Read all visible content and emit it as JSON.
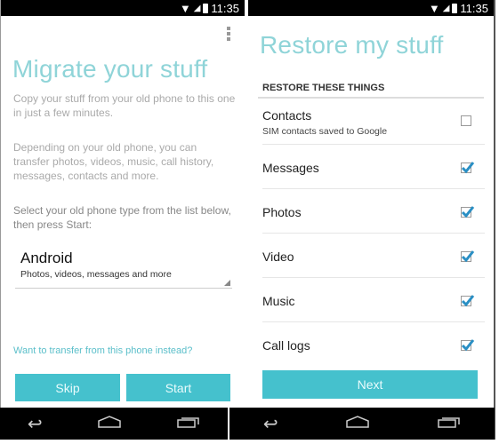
{
  "status_bar": {
    "time": "11:35"
  },
  "migrate": {
    "title": "Migrate your stuff",
    "intro": "Copy your stuff from your old phone to this one in just a few minutes.",
    "details": "Depending on your old phone, you can transfer photos, videos, music, call history, messages, contacts and more.",
    "instruction": "Select your old phone type from the list below, then press Start:",
    "phone_type": {
      "selected": "Android",
      "description": "Photos, videos, messages and more"
    },
    "transfer_link": "Want to transfer from this phone instead?",
    "skip_label": "Skip",
    "start_label": "Start"
  },
  "restore": {
    "title": "Restore my stuff",
    "section_header": "RESTORE THESE THINGS",
    "items": [
      {
        "label": "Contacts",
        "sub": "SIM contacts saved to Google",
        "checked": false
      },
      {
        "label": "Messages",
        "checked": true
      },
      {
        "label": "Photos",
        "checked": true
      },
      {
        "label": "Video",
        "checked": true
      },
      {
        "label": "Music",
        "checked": true
      },
      {
        "label": "Call logs",
        "checked": true
      }
    ],
    "next_label": "Next"
  },
  "colors": {
    "accent": "#45c1cd",
    "title": "#8fd4d8",
    "checkbox": "#2a8fc4"
  }
}
